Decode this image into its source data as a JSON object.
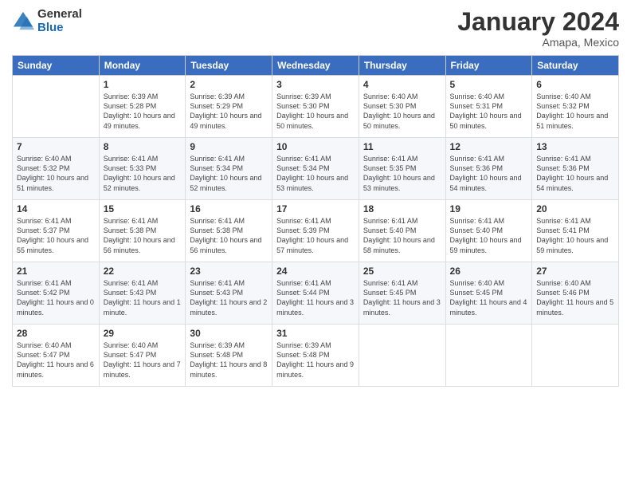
{
  "header": {
    "logo_line1": "General",
    "logo_line2": "Blue",
    "month_title": "January 2024",
    "location": "Amapa, Mexico"
  },
  "days_of_week": [
    "Sunday",
    "Monday",
    "Tuesday",
    "Wednesday",
    "Thursday",
    "Friday",
    "Saturday"
  ],
  "weeks": [
    [
      {
        "num": "",
        "sunrise": "",
        "sunset": "",
        "daylight": ""
      },
      {
        "num": "1",
        "sunrise": "Sunrise: 6:39 AM",
        "sunset": "Sunset: 5:28 PM",
        "daylight": "Daylight: 10 hours and 49 minutes."
      },
      {
        "num": "2",
        "sunrise": "Sunrise: 6:39 AM",
        "sunset": "Sunset: 5:29 PM",
        "daylight": "Daylight: 10 hours and 49 minutes."
      },
      {
        "num": "3",
        "sunrise": "Sunrise: 6:39 AM",
        "sunset": "Sunset: 5:30 PM",
        "daylight": "Daylight: 10 hours and 50 minutes."
      },
      {
        "num": "4",
        "sunrise": "Sunrise: 6:40 AM",
        "sunset": "Sunset: 5:30 PM",
        "daylight": "Daylight: 10 hours and 50 minutes."
      },
      {
        "num": "5",
        "sunrise": "Sunrise: 6:40 AM",
        "sunset": "Sunset: 5:31 PM",
        "daylight": "Daylight: 10 hours and 50 minutes."
      },
      {
        "num": "6",
        "sunrise": "Sunrise: 6:40 AM",
        "sunset": "Sunset: 5:32 PM",
        "daylight": "Daylight: 10 hours and 51 minutes."
      }
    ],
    [
      {
        "num": "7",
        "sunrise": "Sunrise: 6:40 AM",
        "sunset": "Sunset: 5:32 PM",
        "daylight": "Daylight: 10 hours and 51 minutes."
      },
      {
        "num": "8",
        "sunrise": "Sunrise: 6:41 AM",
        "sunset": "Sunset: 5:33 PM",
        "daylight": "Daylight: 10 hours and 52 minutes."
      },
      {
        "num": "9",
        "sunrise": "Sunrise: 6:41 AM",
        "sunset": "Sunset: 5:34 PM",
        "daylight": "Daylight: 10 hours and 52 minutes."
      },
      {
        "num": "10",
        "sunrise": "Sunrise: 6:41 AM",
        "sunset": "Sunset: 5:34 PM",
        "daylight": "Daylight: 10 hours and 53 minutes."
      },
      {
        "num": "11",
        "sunrise": "Sunrise: 6:41 AM",
        "sunset": "Sunset: 5:35 PM",
        "daylight": "Daylight: 10 hours and 53 minutes."
      },
      {
        "num": "12",
        "sunrise": "Sunrise: 6:41 AM",
        "sunset": "Sunset: 5:36 PM",
        "daylight": "Daylight: 10 hours and 54 minutes."
      },
      {
        "num": "13",
        "sunrise": "Sunrise: 6:41 AM",
        "sunset": "Sunset: 5:36 PM",
        "daylight": "Daylight: 10 hours and 54 minutes."
      }
    ],
    [
      {
        "num": "14",
        "sunrise": "Sunrise: 6:41 AM",
        "sunset": "Sunset: 5:37 PM",
        "daylight": "Daylight: 10 hours and 55 minutes."
      },
      {
        "num": "15",
        "sunrise": "Sunrise: 6:41 AM",
        "sunset": "Sunset: 5:38 PM",
        "daylight": "Daylight: 10 hours and 56 minutes."
      },
      {
        "num": "16",
        "sunrise": "Sunrise: 6:41 AM",
        "sunset": "Sunset: 5:38 PM",
        "daylight": "Daylight: 10 hours and 56 minutes."
      },
      {
        "num": "17",
        "sunrise": "Sunrise: 6:41 AM",
        "sunset": "Sunset: 5:39 PM",
        "daylight": "Daylight: 10 hours and 57 minutes."
      },
      {
        "num": "18",
        "sunrise": "Sunrise: 6:41 AM",
        "sunset": "Sunset: 5:40 PM",
        "daylight": "Daylight: 10 hours and 58 minutes."
      },
      {
        "num": "19",
        "sunrise": "Sunrise: 6:41 AM",
        "sunset": "Sunset: 5:40 PM",
        "daylight": "Daylight: 10 hours and 59 minutes."
      },
      {
        "num": "20",
        "sunrise": "Sunrise: 6:41 AM",
        "sunset": "Sunset: 5:41 PM",
        "daylight": "Daylight: 10 hours and 59 minutes."
      }
    ],
    [
      {
        "num": "21",
        "sunrise": "Sunrise: 6:41 AM",
        "sunset": "Sunset: 5:42 PM",
        "daylight": "Daylight: 11 hours and 0 minutes."
      },
      {
        "num": "22",
        "sunrise": "Sunrise: 6:41 AM",
        "sunset": "Sunset: 5:43 PM",
        "daylight": "Daylight: 11 hours and 1 minute."
      },
      {
        "num": "23",
        "sunrise": "Sunrise: 6:41 AM",
        "sunset": "Sunset: 5:43 PM",
        "daylight": "Daylight: 11 hours and 2 minutes."
      },
      {
        "num": "24",
        "sunrise": "Sunrise: 6:41 AM",
        "sunset": "Sunset: 5:44 PM",
        "daylight": "Daylight: 11 hours and 3 minutes."
      },
      {
        "num": "25",
        "sunrise": "Sunrise: 6:41 AM",
        "sunset": "Sunset: 5:45 PM",
        "daylight": "Daylight: 11 hours and 3 minutes."
      },
      {
        "num": "26",
        "sunrise": "Sunrise: 6:40 AM",
        "sunset": "Sunset: 5:45 PM",
        "daylight": "Daylight: 11 hours and 4 minutes."
      },
      {
        "num": "27",
        "sunrise": "Sunrise: 6:40 AM",
        "sunset": "Sunset: 5:46 PM",
        "daylight": "Daylight: 11 hours and 5 minutes."
      }
    ],
    [
      {
        "num": "28",
        "sunrise": "Sunrise: 6:40 AM",
        "sunset": "Sunset: 5:47 PM",
        "daylight": "Daylight: 11 hours and 6 minutes."
      },
      {
        "num": "29",
        "sunrise": "Sunrise: 6:40 AM",
        "sunset": "Sunset: 5:47 PM",
        "daylight": "Daylight: 11 hours and 7 minutes."
      },
      {
        "num": "30",
        "sunrise": "Sunrise: 6:39 AM",
        "sunset": "Sunset: 5:48 PM",
        "daylight": "Daylight: 11 hours and 8 minutes."
      },
      {
        "num": "31",
        "sunrise": "Sunrise: 6:39 AM",
        "sunset": "Sunset: 5:48 PM",
        "daylight": "Daylight: 11 hours and 9 minutes."
      },
      {
        "num": "",
        "sunrise": "",
        "sunset": "",
        "daylight": ""
      },
      {
        "num": "",
        "sunrise": "",
        "sunset": "",
        "daylight": ""
      },
      {
        "num": "",
        "sunrise": "",
        "sunset": "",
        "daylight": ""
      }
    ]
  ]
}
